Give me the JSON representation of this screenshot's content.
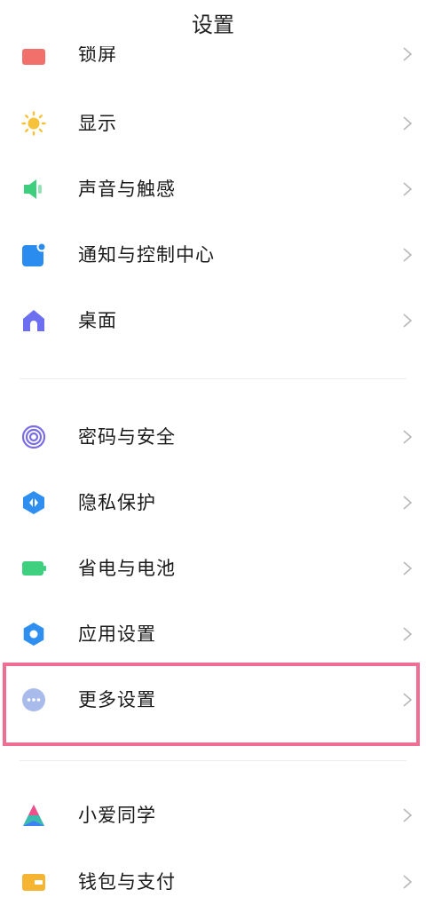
{
  "header": {
    "title": "设置"
  },
  "groups": [
    {
      "items": [
        {
          "id": "lockscreen",
          "label": "锁屏",
          "icon": "lock-screen-icon",
          "color": "#f2706b"
        },
        {
          "id": "display",
          "label": "显示",
          "icon": "sun-icon",
          "color": "#f7c23b"
        },
        {
          "id": "sound",
          "label": "声音与触感",
          "icon": "speaker-icon",
          "color": "#3dcf7e"
        },
        {
          "id": "notifications",
          "label": "通知与控制中心",
          "icon": "notification-icon",
          "color": "#2b8cf0"
        },
        {
          "id": "home",
          "label": "桌面",
          "icon": "home-icon",
          "color": "#6b6ff0"
        }
      ]
    },
    {
      "items": [
        {
          "id": "password",
          "label": "密码与安全",
          "icon": "fingerprint-icon",
          "color": "#7a6ce6"
        },
        {
          "id": "privacy",
          "label": "隐私保护",
          "icon": "privacy-shield-icon",
          "color": "#2e8ff0"
        },
        {
          "id": "battery",
          "label": "省电与电池",
          "icon": "battery-icon",
          "color": "#3ed07f"
        },
        {
          "id": "apps",
          "label": "应用设置",
          "icon": "gear-icon",
          "color": "#2e8ff0"
        },
        {
          "id": "more",
          "label": "更多设置",
          "icon": "more-dots-icon",
          "color": "#9fb2e6",
          "highlighted": true
        }
      ]
    },
    {
      "items": [
        {
          "id": "xiaoai",
          "label": "小爱同学",
          "icon": "xiaoai-icon",
          "color": "#3b82f6"
        },
        {
          "id": "wallet",
          "label": "钱包与支付",
          "icon": "wallet-icon",
          "color": "#f5b533"
        }
      ]
    }
  ],
  "highlight": {
    "color": "#ef6e93",
    "target": "更多设置"
  }
}
